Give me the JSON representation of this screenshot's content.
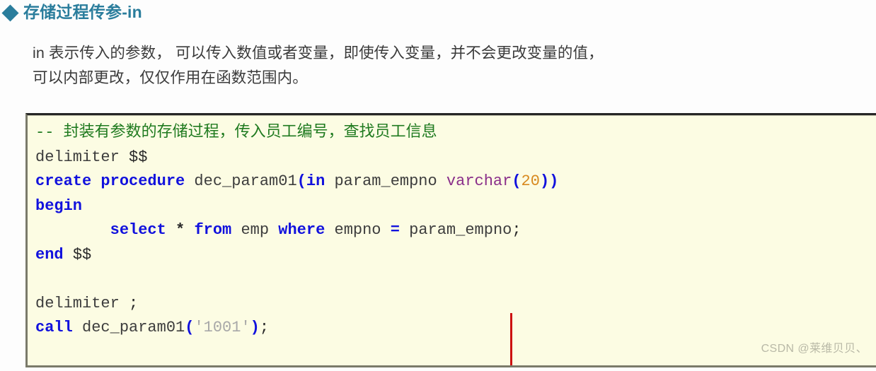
{
  "heading": {
    "bullet": "diamond-bullet-icon",
    "text": "存储过程传参-in",
    "color": "#2a7d9c"
  },
  "paragraph": {
    "line1": "in 表示传入的参数， 可以传入数值或者变量，即使传入变量，并不会更改变量的值，",
    "line2": "可以内部更改，仅仅作用在函数范围内。"
  },
  "code_block": {
    "background": "#fcfce3",
    "border_top_color": "#262626",
    "border_color": "#7a7a6a",
    "lines": [
      {
        "id": "line-comment",
        "tokens": [
          {
            "t": "-- 封装有参数的存储过程，传入员工编号，查找员工信息",
            "c": "tok-comment"
          }
        ]
      },
      {
        "id": "line-delimiter-dollar",
        "tokens": [
          {
            "t": "delimiter ",
            "c": "tok-plain"
          },
          {
            "t": "$$",
            "c": "tok-punct"
          }
        ]
      },
      {
        "id": "line-create-procedure",
        "tokens": [
          {
            "t": "create procedure",
            "c": "tok-kw"
          },
          {
            "t": " dec_param01",
            "c": "tok-plain"
          },
          {
            "t": "(",
            "c": "tok-paren"
          },
          {
            "t": "in",
            "c": "tok-kw"
          },
          {
            "t": " param_empno ",
            "c": "tok-plain"
          },
          {
            "t": "varchar",
            "c": "tok-type"
          },
          {
            "t": "(",
            "c": "tok-paren"
          },
          {
            "t": "20",
            "c": "tok-num"
          },
          {
            "t": "))",
            "c": "tok-paren"
          }
        ]
      },
      {
        "id": "line-begin",
        "tokens": [
          {
            "t": "begin",
            "c": "tok-kw"
          }
        ]
      },
      {
        "id": "line-select",
        "tokens": [
          {
            "t": "        ",
            "c": "tok-plain"
          },
          {
            "t": "select",
            "c": "tok-kw"
          },
          {
            "t": " ",
            "c": "tok-plain"
          },
          {
            "t": "*",
            "c": "tok-opdark"
          },
          {
            "t": " ",
            "c": "tok-plain"
          },
          {
            "t": "from",
            "c": "tok-kw"
          },
          {
            "t": " emp ",
            "c": "tok-plain"
          },
          {
            "t": "where",
            "c": "tok-kw"
          },
          {
            "t": " empno ",
            "c": "tok-plain"
          },
          {
            "t": "=",
            "c": "tok-op"
          },
          {
            "t": " param_empno",
            "c": "tok-plain"
          },
          {
            "t": ";",
            "c": "tok-punct"
          }
        ]
      },
      {
        "id": "line-end",
        "tokens": [
          {
            "t": "end",
            "c": "tok-kw"
          },
          {
            "t": " ",
            "c": "tok-plain"
          },
          {
            "t": "$$",
            "c": "tok-punct"
          }
        ]
      },
      {
        "id": "line-blank",
        "tokens": [
          {
            "t": " ",
            "c": "tok-plain"
          }
        ]
      },
      {
        "id": "line-delimiter-semicolon",
        "tokens": [
          {
            "t": "delimiter ",
            "c": "tok-plain"
          },
          {
            "t": ";",
            "c": "tok-punct"
          }
        ]
      },
      {
        "id": "line-call",
        "tokens": [
          {
            "t": "call",
            "c": "tok-kw"
          },
          {
            "t": " dec_param01",
            "c": "tok-plain"
          },
          {
            "t": "(",
            "c": "tok-paren"
          },
          {
            "t": "'1001'",
            "c": "tok-str"
          },
          {
            "t": ")",
            "c": "tok-paren"
          },
          {
            "t": ";",
            "c": "tok-punct"
          }
        ]
      }
    ]
  },
  "caret": {
    "color": "#cc1111"
  },
  "watermark": {
    "text": "CSDN @莱维贝贝、",
    "color": "#b9b9a7"
  }
}
